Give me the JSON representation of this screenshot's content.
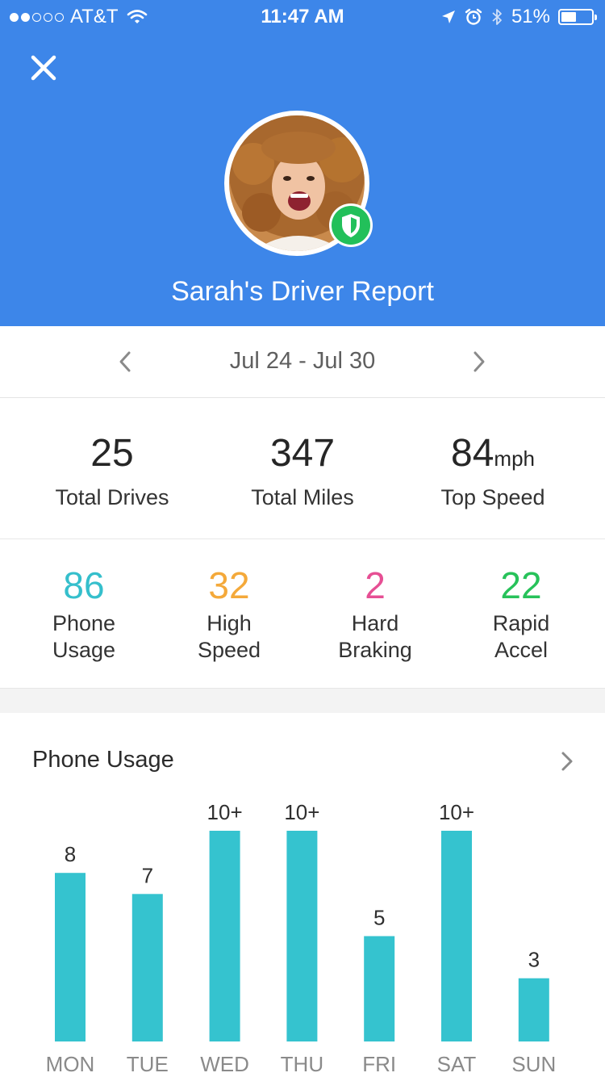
{
  "status_bar": {
    "carrier": "AT&T",
    "time": "11:47 AM",
    "battery": "51%",
    "battery_level": 0.51,
    "signal_bars": 2,
    "signal_total": 5
  },
  "header": {
    "title": "Sarah's Driver Report",
    "background_color": "#3d86e9",
    "badge_color": "#22c05a"
  },
  "date_nav": {
    "range": "Jul 24 - Jul 30"
  },
  "totals": [
    {
      "value": "25",
      "unit": "",
      "label": "Total Drives"
    },
    {
      "value": "347",
      "unit": "",
      "label": "Total Miles"
    },
    {
      "value": "84",
      "unit": "mph",
      "label": "Top Speed"
    }
  ],
  "events": [
    {
      "value": "86",
      "label_line1": "Phone",
      "label_line2": "Usage",
      "color": "#35bfcc"
    },
    {
      "value": "32",
      "label_line1": "High",
      "label_line2": "Speed",
      "color": "#f4a93a"
    },
    {
      "value": "2",
      "label_line1": "Hard",
      "label_line2": "Braking",
      "color": "#e64f94"
    },
    {
      "value": "22",
      "label_line1": "Rapid",
      "label_line2": "Accel",
      "color": "#27c25a"
    }
  ],
  "phone_usage_card": {
    "title": "Phone Usage"
  },
  "chart_data": {
    "type": "bar",
    "categories": [
      "MON",
      "TUE",
      "WED",
      "THU",
      "FRI",
      "SAT",
      "SUN"
    ],
    "values": [
      8,
      7,
      10,
      10,
      5,
      10,
      3
    ],
    "data_labels": [
      "8",
      "7",
      "10+",
      "10+",
      "5",
      "10+",
      "3"
    ],
    "ylim": [
      0,
      10
    ],
    "bar_color": "#35c3cf",
    "grid": false,
    "legend": "none",
    "title": "Phone Usage",
    "xlabel": "",
    "ylabel": ""
  }
}
